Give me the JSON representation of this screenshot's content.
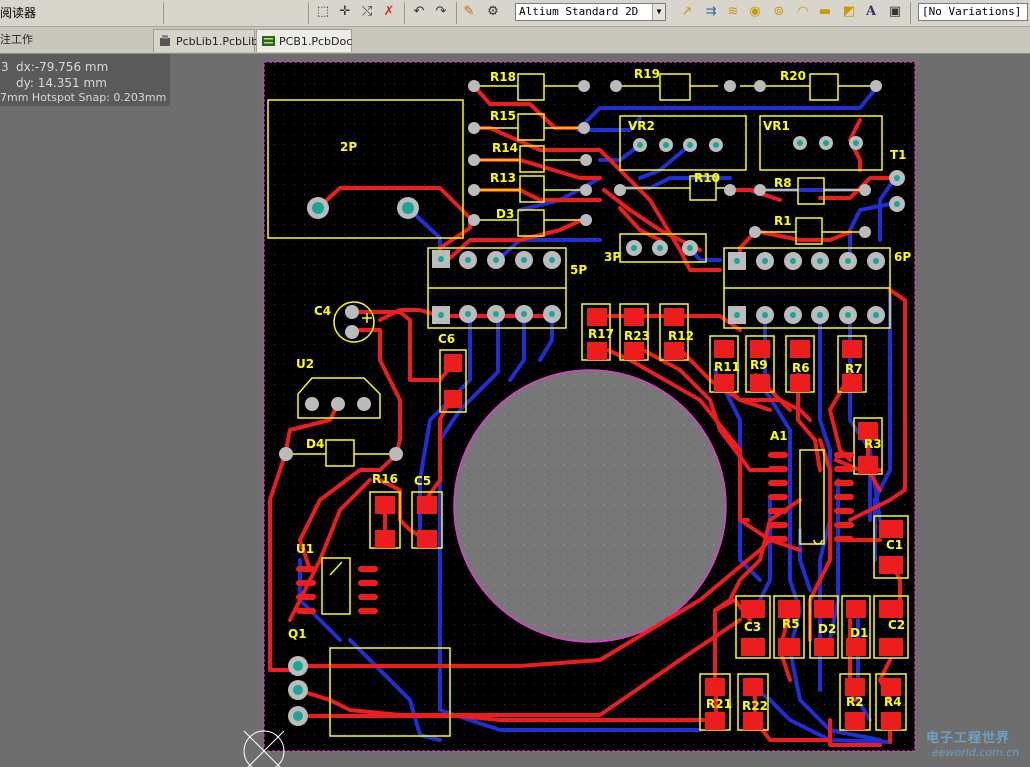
{
  "toolbar": {
    "title_fragment": "阅读器",
    "view_mode": "Altium Standard 2D",
    "variations": "[No Variations]"
  },
  "tabs": {
    "left_fragment": "注工作",
    "items": [
      {
        "label": "PcbLib1.PcbLib"
      },
      {
        "label": "PCB1.PcbDoc"
      }
    ]
  },
  "hud": {
    "prefix": "3",
    "dx": "dx:-79.756 mm",
    "dy": "dy: 14.351 mm",
    "snap": "7mm Hotspot Snap: 0.203mm"
  },
  "components": {
    "connectors": [
      "2P",
      "5P",
      "3P",
      "6P"
    ],
    "resistors": [
      "R18",
      "R19",
      "R20",
      "R15",
      "R14",
      "R13",
      "R10",
      "R8",
      "R1",
      "R17",
      "R23",
      "R12",
      "R11",
      "R9",
      "R6",
      "R7",
      "R3",
      "R16",
      "R5",
      "R21",
      "R22",
      "R2",
      "R4"
    ],
    "trimmers": [
      "VR2",
      "VR1"
    ],
    "other": [
      "T1",
      "D3",
      "C4",
      "C6",
      "U2",
      "D4",
      "A1",
      "C5",
      "U1",
      "C1",
      "C3",
      "D2",
      "D1",
      "C2",
      "Q1"
    ]
  },
  "watermark": {
    "line1": "电子工程世界",
    "line2": "eeworld.com.cn"
  }
}
